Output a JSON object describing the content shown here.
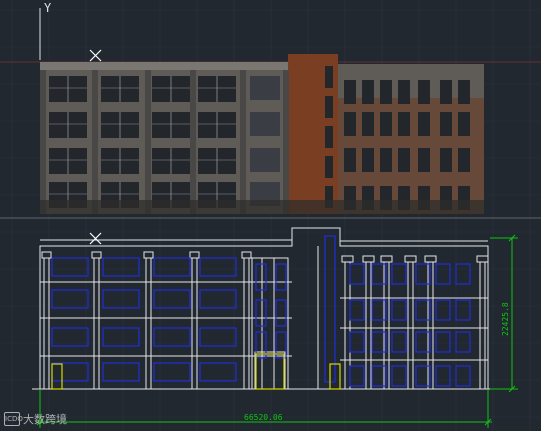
{
  "viewport": {
    "ucs_axis_label": "Y",
    "background": "#212830",
    "grid_color": "#2b333d"
  },
  "drawing": {
    "photo_layer_colors": {
      "facade_gray": "#5f5c58",
      "facade_dark": "#2e2c2a",
      "brick": "#7a3e22",
      "window_dark": "#23272c",
      "window_light": "#8e959c"
    },
    "line_colors": {
      "outline": "#e6e6e6",
      "windows": "#1f2fd6",
      "doors": "#d8d800",
      "dimension": "#10c410",
      "reference": "#c83a3a"
    },
    "dimensions": {
      "horizontal_text": "66520.06",
      "vertical_text": "22425.8"
    }
  },
  "watermark": {
    "logo_text": "ICDO",
    "text": "大数跨境"
  }
}
